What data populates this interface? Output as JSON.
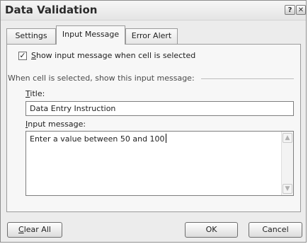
{
  "window": {
    "title": "Data Validation",
    "help_glyph": "?",
    "close_glyph": "✕"
  },
  "tabs": [
    {
      "label": "Settings",
      "selected": false
    },
    {
      "label": "Input Message",
      "selected": true
    },
    {
      "label": "Error Alert",
      "selected": false
    }
  ],
  "input_message": {
    "show_checkbox": {
      "checked": true,
      "mnemonic": "S",
      "label_rest": "how input message when cell is selected"
    },
    "group_label": "When cell is selected, show this input message:",
    "title_field": {
      "mnemonic": "T",
      "label_rest": "itle:",
      "value": "Data Entry Instruction"
    },
    "message_field": {
      "mnemonic": "I",
      "label_rest": "nput message:",
      "value": "Enter a value between 50 and 100"
    }
  },
  "buttons": {
    "clear_mnemonic": "C",
    "clear_rest": "lear All",
    "ok": "OK",
    "cancel": "Cancel"
  }
}
